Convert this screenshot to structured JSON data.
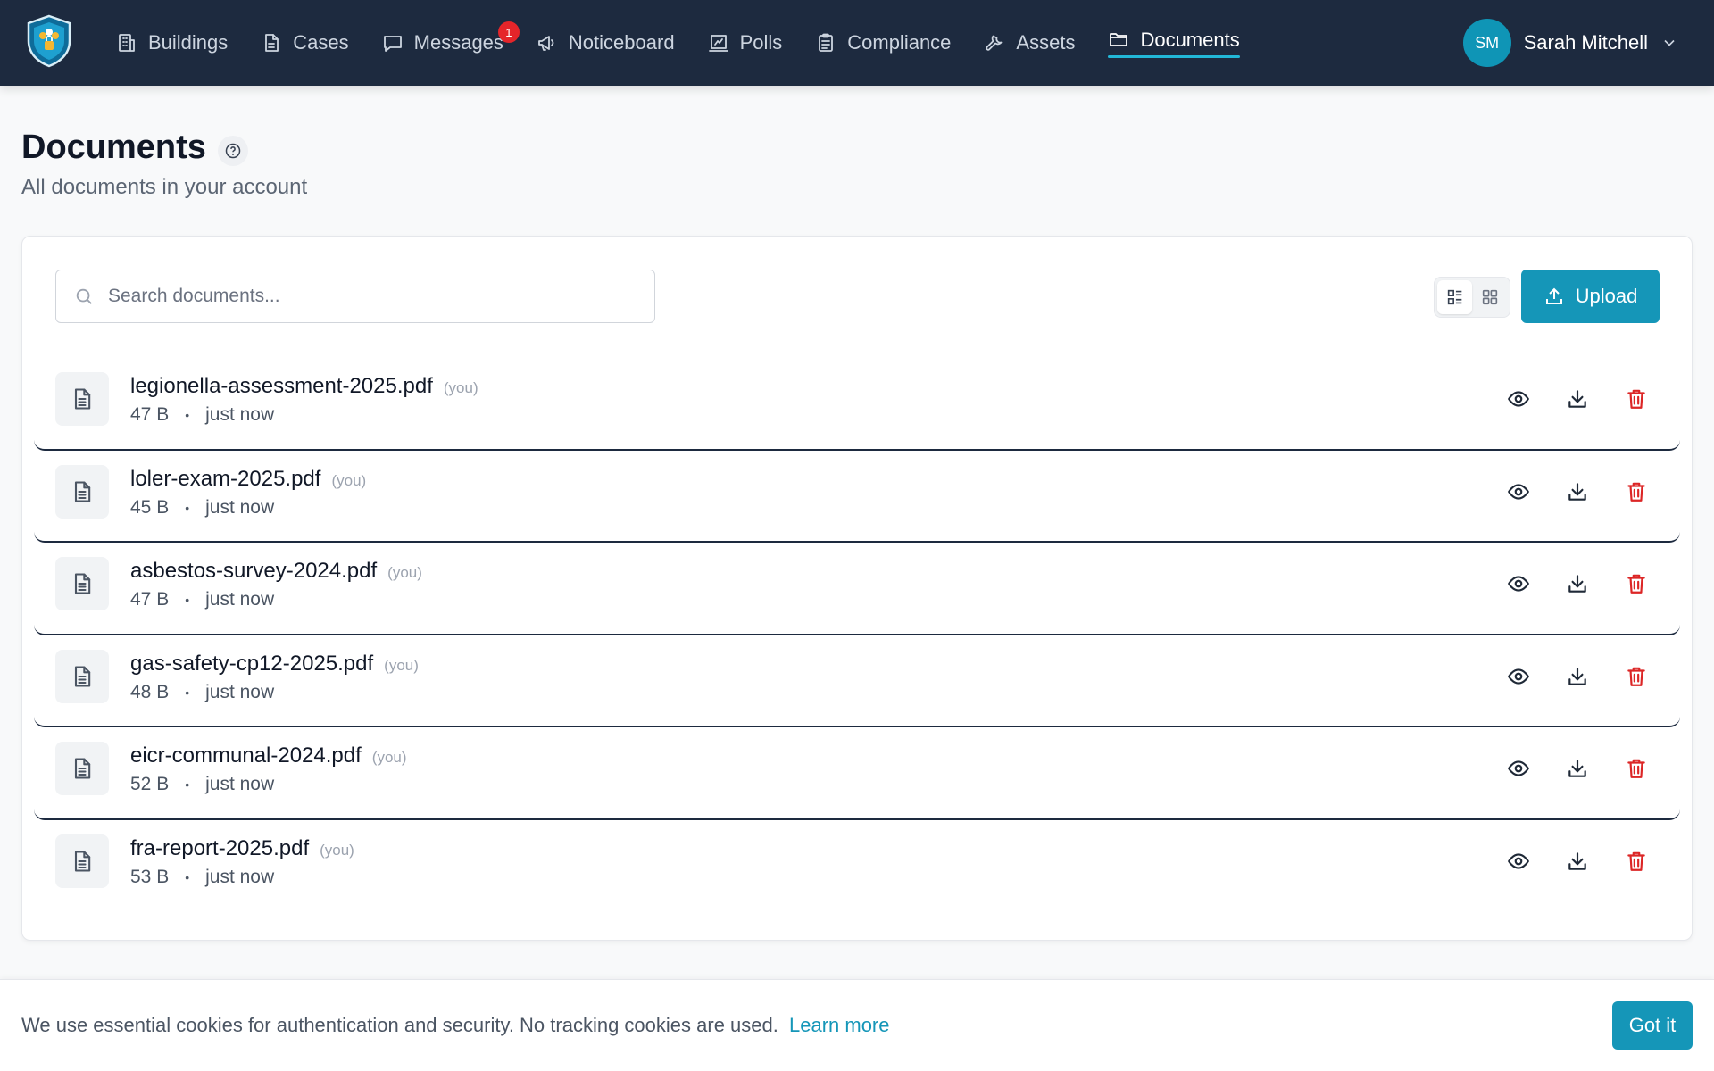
{
  "nav": {
    "items": [
      {
        "label": "Buildings",
        "icon": "building-icon"
      },
      {
        "label": "Cases",
        "icon": "file-icon"
      },
      {
        "label": "Messages",
        "icon": "message-icon",
        "badge": "1"
      },
      {
        "label": "Noticeboard",
        "icon": "megaphone-icon"
      },
      {
        "label": "Polls",
        "icon": "poll-icon"
      },
      {
        "label": "Compliance",
        "icon": "clipboard-icon"
      },
      {
        "label": "Assets",
        "icon": "wrench-icon"
      },
      {
        "label": "Documents",
        "icon": "folder-icon",
        "active": true
      }
    ],
    "user": {
      "initials": "SM",
      "name": "Sarah Mitchell"
    }
  },
  "page": {
    "title": "Documents",
    "subtitle": "All documents in your account"
  },
  "toolbar": {
    "search_placeholder": "Search documents...",
    "upload_label": "Upload",
    "view_mode": "list"
  },
  "documents": [
    {
      "name": "legionella-assessment-2025.pdf",
      "owner_tag": "(you)",
      "size": "47 B",
      "time": "just now"
    },
    {
      "name": "loler-exam-2025.pdf",
      "owner_tag": "(you)",
      "size": "45 B",
      "time": "just now"
    },
    {
      "name": "asbestos-survey-2024.pdf",
      "owner_tag": "(you)",
      "size": "47 B",
      "time": "just now"
    },
    {
      "name": "gas-safety-cp12-2025.pdf",
      "owner_tag": "(you)",
      "size": "48 B",
      "time": "just now"
    },
    {
      "name": "eicr-communal-2024.pdf",
      "owner_tag": "(you)",
      "size": "52 B",
      "time": "just now"
    },
    {
      "name": "fra-report-2025.pdf",
      "owner_tag": "(you)",
      "size": "53 B",
      "time": "just now"
    }
  ],
  "cookie": {
    "text": "We use essential cookies for authentication and security. No tracking cookies are used.",
    "link": "Learn more",
    "button": "Got it"
  },
  "colors": {
    "navbar": "#1d2a3f",
    "accent": "#1596b8",
    "active_underline": "#22b8d8",
    "badge": "#e5252a",
    "delete": "#dc2626"
  }
}
